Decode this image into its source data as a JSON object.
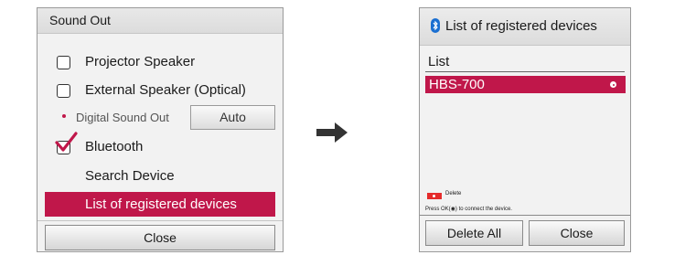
{
  "sound_out": {
    "title": "Sound Out",
    "options": [
      {
        "label": "Projector Speaker",
        "checked": false
      },
      {
        "label": "External Speaker (Optical)",
        "checked": false
      }
    ],
    "digital_sound_out": {
      "label": "Digital Sound Out",
      "value": "Auto"
    },
    "bluetooth": {
      "label": "Bluetooth",
      "checked": true
    },
    "search_device": "Search Device",
    "registered_devices": "List of registered devices",
    "close": "Close"
  },
  "registered": {
    "title": "List of registered devices",
    "list_header": "List",
    "devices": [
      {
        "name": "HBS-700",
        "selected": true
      }
    ],
    "delete_hint": "Delete",
    "ok_hint": "Press OK(◉) to connect the device.",
    "delete_all": "Delete All",
    "close": "Close"
  },
  "colors": {
    "accent": "#c0174a",
    "red_key": "#e52b2b"
  },
  "icons": {
    "arrow": "arrow-right-icon",
    "bluetooth": "bluetooth-icon",
    "check": "check-mark-icon"
  }
}
